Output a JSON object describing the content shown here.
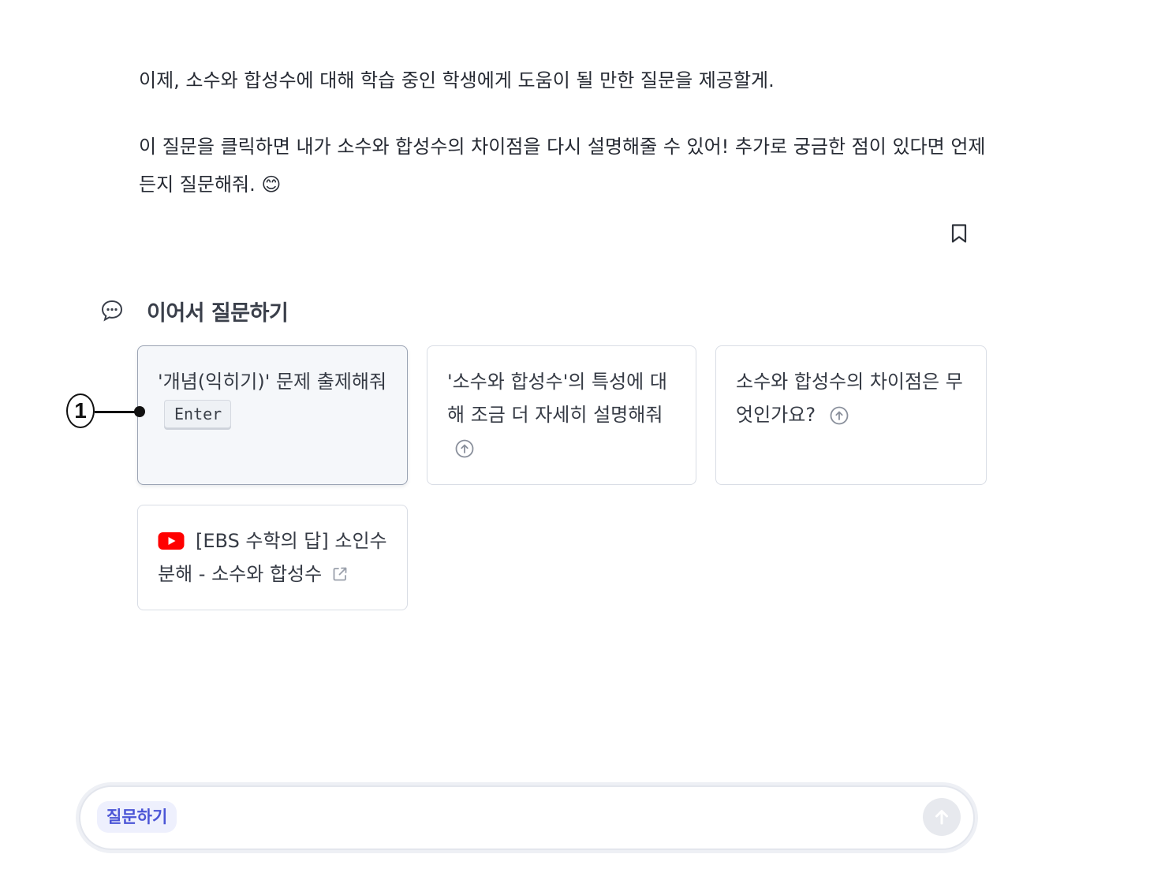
{
  "message": {
    "paragraph1": "이제, 소수와 합성수에 대해 학습 중인 학생에게 도움이 될 만한 질문을 제공할게.",
    "paragraph2": "이 질문을 클릭하면 내가 소수와 합성수의 차이점을 다시 설명해줄 수 있어! 추가로 궁금한 점이 있다면 언제든지 질문해줘. 😊"
  },
  "followup": {
    "title": "이어서 질문하기",
    "cards": [
      {
        "text": "'개념(익히기)' 문제 출제해줘",
        "key_hint": "Enter"
      },
      {
        "text": "'소수와 합성수'의 특성에 대해 조금 더 자세히 설명해줘"
      },
      {
        "text": "소수와 합성수의 차이점은 무엇인가요?"
      },
      {
        "text": "[EBS 수학의 답] 소인수분해 - 소수와 합성수",
        "icon": "youtube-icon"
      }
    ]
  },
  "annotation": {
    "number": "1"
  },
  "input": {
    "chip": "질문하기",
    "value": ""
  },
  "colors": {
    "accent": "#4b55d6",
    "youtube": "#ff0000",
    "card_border": "#d9dde5"
  }
}
